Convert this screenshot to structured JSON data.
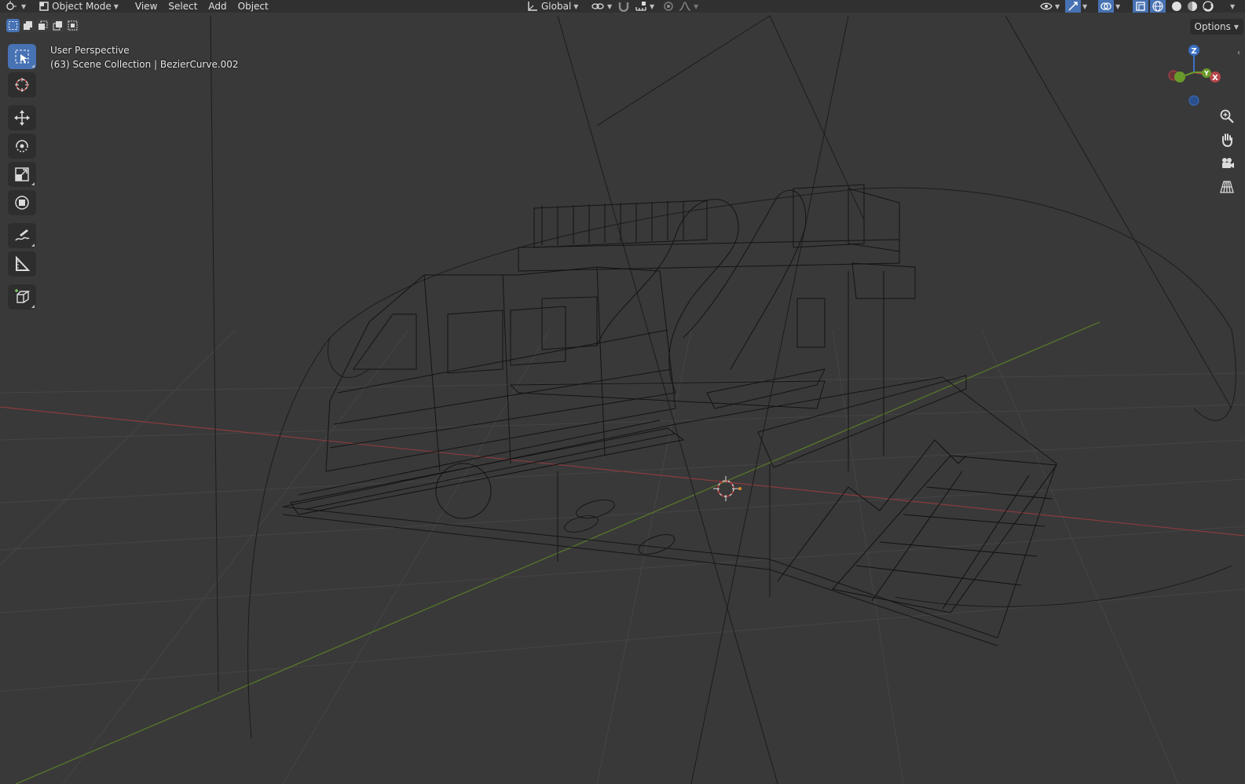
{
  "header": {
    "editor_type_icon": "view3d-icon",
    "mode_label": "Object Mode",
    "menus": [
      "View",
      "Select",
      "Add",
      "Object"
    ],
    "transform_orientation": "Global"
  },
  "viewport": {
    "perspective_label": "User Perspective",
    "collection_label": "(63) Scene Collection | BezierCurve.002"
  },
  "options_label": "Options",
  "gizmo": {
    "x": "X",
    "y": "Y",
    "z": "Z"
  },
  "tools": [
    "select-box-icon",
    "cursor-icon",
    "move-icon",
    "rotate-icon",
    "scale-icon",
    "transform-icon",
    "annotate-icon",
    "measure-icon",
    "add-cube-icon"
  ],
  "colors": {
    "accent": "#4772b3",
    "x_axis": "#b5454a",
    "y_axis": "#6a9a2c",
    "z_axis": "#3b6fc2"
  }
}
